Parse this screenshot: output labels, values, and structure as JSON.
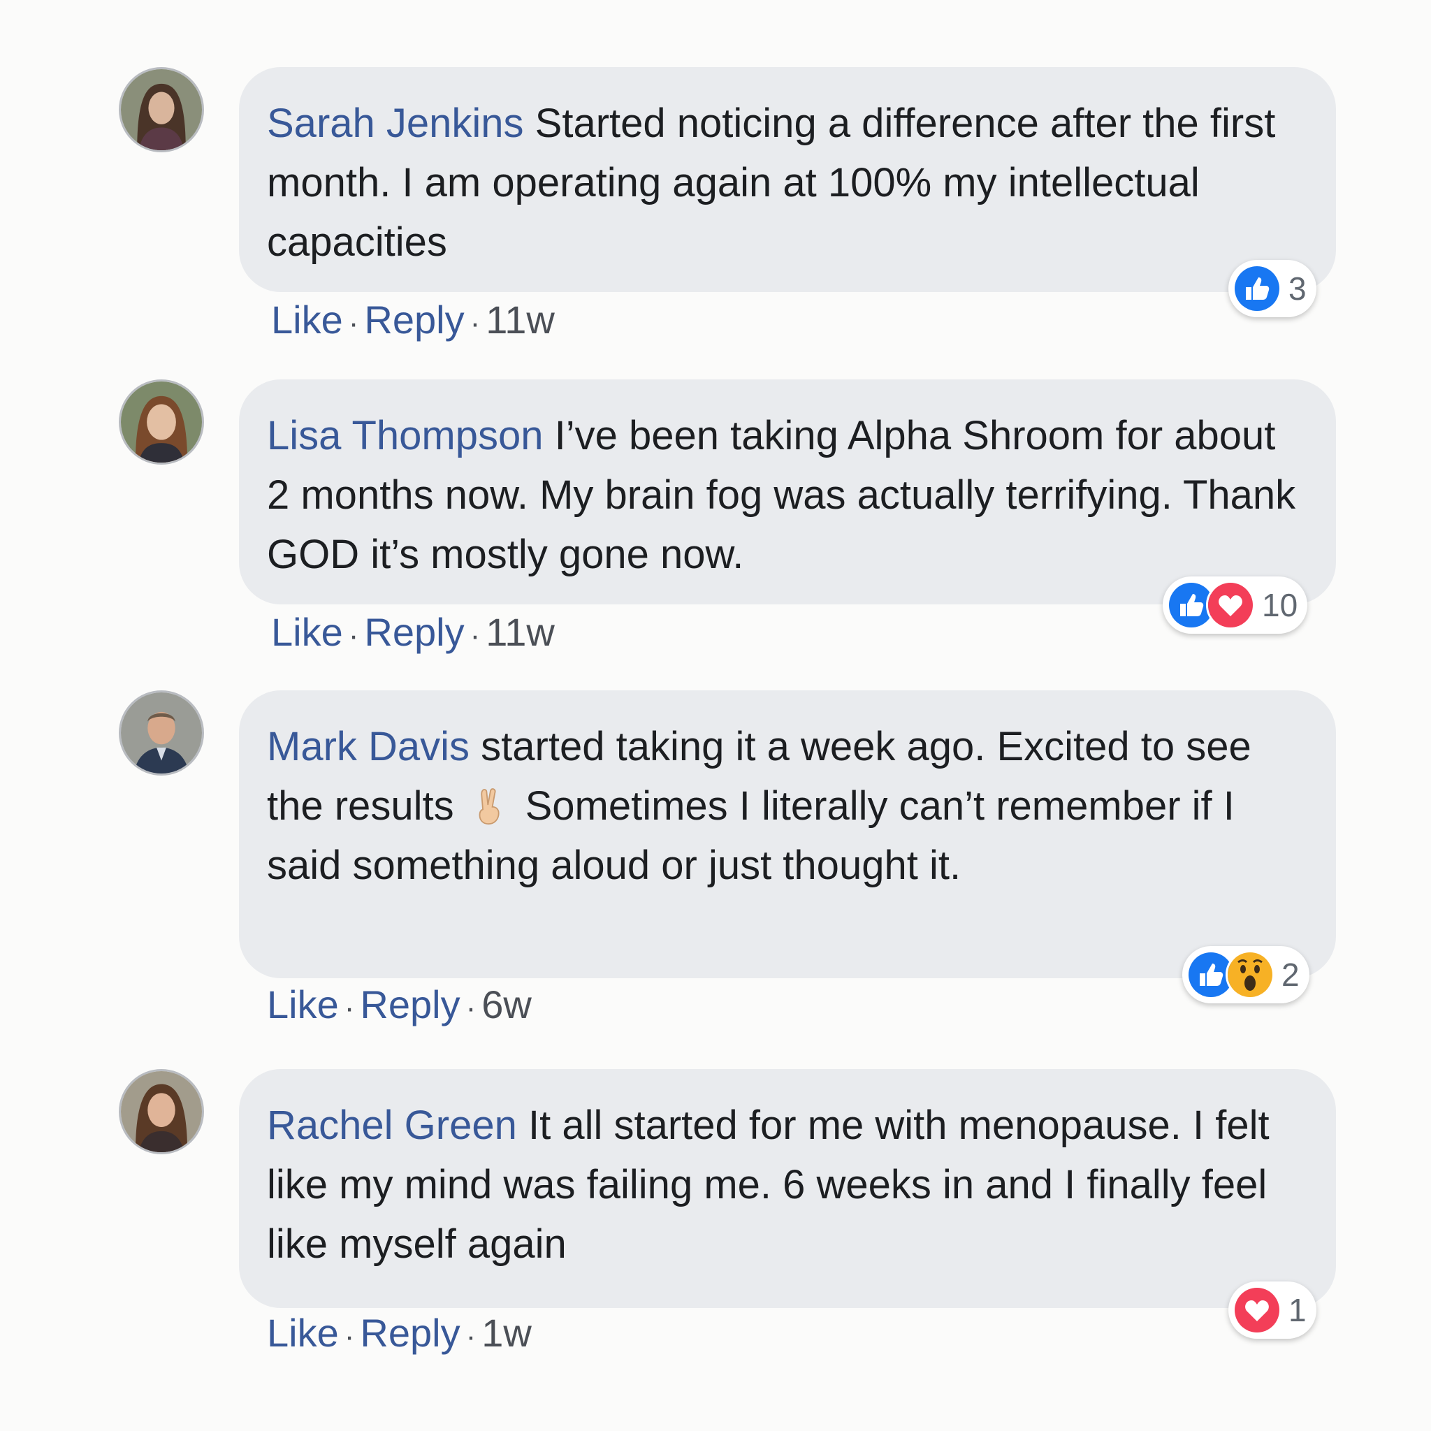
{
  "comments": [
    {
      "author": "Sarah Jenkins",
      "text": "Started noticing a difference after the first month. I am operating again at 100% my intellectual capacities",
      "actions": {
        "like": "Like",
        "reply": "Reply",
        "separator": "·",
        "time": "11w"
      },
      "reactions": {
        "icons": [
          "like-icon"
        ],
        "count": "3"
      }
    },
    {
      "author": "Lisa Thompson",
      "text": "I’ve been taking Alpha Shroom for about 2 months now. My brain fog was actually terrifying. Thank GOD it’s mostly gone now.",
      "actions": {
        "like": "Like",
        "reply": "Reply",
        "separator": "·",
        "time": "11w"
      },
      "reactions": {
        "icons": [
          "like-icon",
          "love-icon"
        ],
        "count": "10"
      }
    },
    {
      "author": "Mark Davis",
      "text_before_emoji": "started taking it a week ago. Excited to see the results",
      "emoji": "victory-hand-emoji",
      "text_after_emoji": "Sometimes I literally can’t remember if I said something aloud or just thought it.",
      "actions": {
        "like": "Like",
        "reply": "Reply",
        "separator": "·",
        "time": "6w"
      },
      "reactions": {
        "icons": [
          "like-icon",
          "wow-icon"
        ],
        "count": "2"
      }
    },
    {
      "author": "Rachel Green",
      "text": "It all started for me with menopause. I felt like my mind was failing me. 6 weeks in and I finally feel like myself again",
      "actions": {
        "like": "Like",
        "reply": "Reply",
        "separator": "·",
        "time": "1w"
      },
      "reactions": {
        "icons": [
          "love-icon"
        ],
        "count": "1"
      }
    }
  ],
  "colors": {
    "author_link": "#385898",
    "bubble_bg": "#e9ebee",
    "like_blue": "#1877f2",
    "love_red": "#f33e58",
    "wow_yellow": "#f7b125"
  }
}
